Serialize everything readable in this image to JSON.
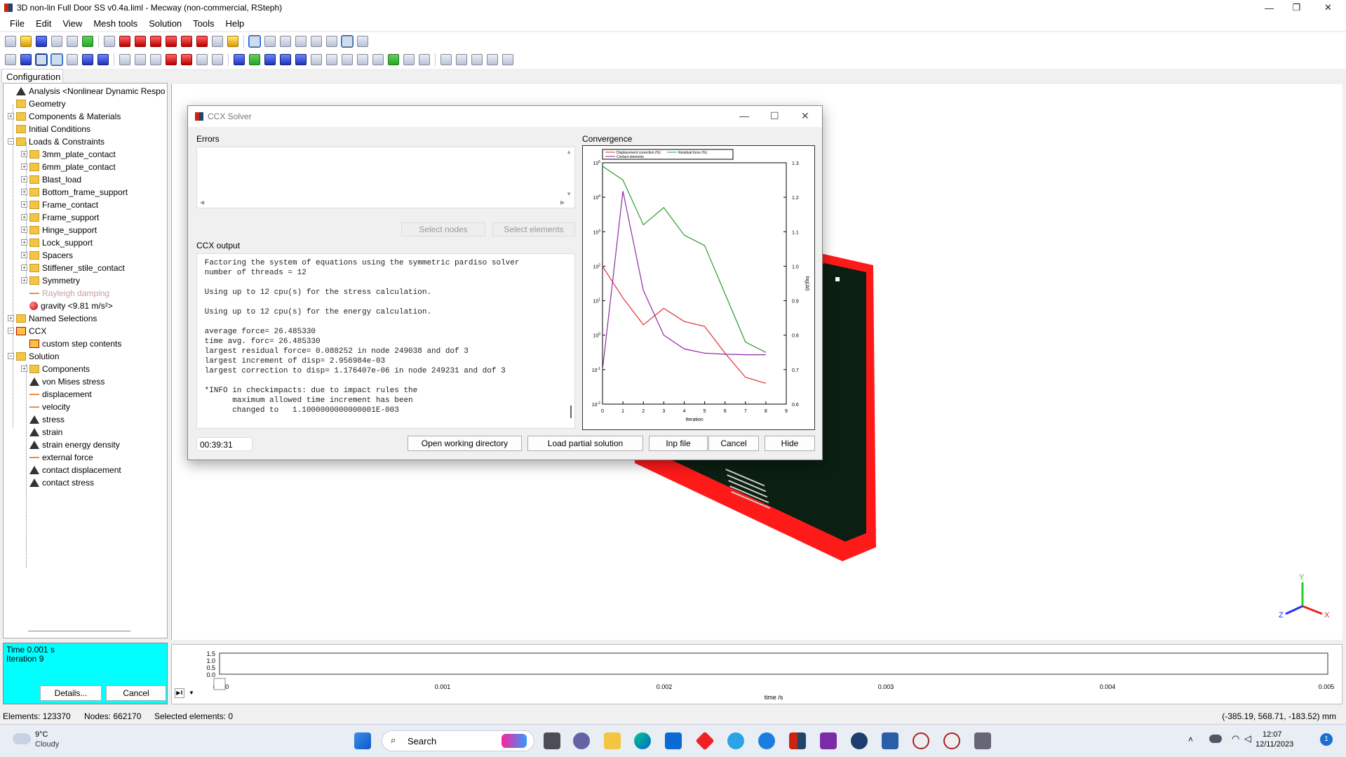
{
  "window": {
    "title": "3D non-lin Full Door SS v0.4a.liml - Mecway (non-commercial, RSteph)"
  },
  "menu": [
    "File",
    "Edit",
    "View",
    "Mesh tools",
    "Solution",
    "Tools",
    "Help"
  ],
  "config_tab": "Configuration",
  "tree": [
    {
      "label": "Analysis <Nonlinear Dynamic Respo",
      "icon": "analysis-icon",
      "level": 0,
      "expander": ""
    },
    {
      "label": "Geometry",
      "icon": "folder-icon",
      "level": 0,
      "expander": ""
    },
    {
      "label": "Components & Materials",
      "icon": "folder-icon",
      "level": 0,
      "expander": "+"
    },
    {
      "label": "Initial Conditions",
      "icon": "initial-conditions-icon",
      "level": 0,
      "expander": ""
    },
    {
      "label": "Loads & Constraints",
      "icon": "folder-icon",
      "level": 0,
      "expander": "-"
    },
    {
      "label": "3mm_plate_contact",
      "icon": "folder-icon",
      "level": 1,
      "expander": "+"
    },
    {
      "label": "6mm_plate_contact",
      "icon": "folder-icon",
      "level": 1,
      "expander": "+"
    },
    {
      "label": "Blast_load",
      "icon": "folder-icon",
      "level": 1,
      "expander": "+"
    },
    {
      "label": "Bottom_frame_support",
      "icon": "folder-icon",
      "level": 1,
      "expander": "+"
    },
    {
      "label": "Frame_contact",
      "icon": "folder-icon",
      "level": 1,
      "expander": "+"
    },
    {
      "label": "Frame_support",
      "icon": "folder-icon",
      "level": 1,
      "expander": "+"
    },
    {
      "label": "Hinge_support",
      "icon": "folder-icon",
      "level": 1,
      "expander": "+"
    },
    {
      "label": "Lock_support",
      "icon": "folder-icon",
      "level": 1,
      "expander": "+"
    },
    {
      "label": "Spacers",
      "icon": "folder-icon",
      "level": 1,
      "expander": "+"
    },
    {
      "label": "Stiffener_stile_contact",
      "icon": "folder-icon",
      "level": 1,
      "expander": "+"
    },
    {
      "label": "Symmetry",
      "icon": "folder-icon",
      "level": 1,
      "expander": "+"
    },
    {
      "label": "Rayleigh damping",
      "icon": "damping-icon",
      "level": 1,
      "expander": "",
      "disabled": true
    },
    {
      "label": "gravity <9.81 m/s²>",
      "icon": "gravity-icon",
      "level": 1,
      "expander": ""
    },
    {
      "label": "Named Selections",
      "icon": "folder-icon",
      "level": 0,
      "expander": "+"
    },
    {
      "label": "CCX",
      "icon": "ccx-icon",
      "level": 0,
      "expander": "-"
    },
    {
      "label": "custom step contents",
      "icon": "ccx-icon",
      "level": 1,
      "expander": ""
    },
    {
      "label": "Solution",
      "icon": "solution-icon",
      "level": 0,
      "expander": "-"
    },
    {
      "label": "Components",
      "icon": "folder-icon",
      "level": 1,
      "expander": "+"
    },
    {
      "label": "von Mises stress",
      "icon": "triangle-icon",
      "level": 1,
      "expander": ""
    },
    {
      "label": "displacement",
      "icon": "arrow-icon",
      "level": 1,
      "expander": ""
    },
    {
      "label": "velocity",
      "icon": "arrow-icon",
      "level": 1,
      "expander": ""
    },
    {
      "label": "stress",
      "icon": "triangle-icon",
      "level": 1,
      "expander": ""
    },
    {
      "label": "strain",
      "icon": "triangle-icon",
      "level": 1,
      "expander": ""
    },
    {
      "label": "strain energy density",
      "icon": "triangle-icon",
      "level": 1,
      "expander": ""
    },
    {
      "label": "external force",
      "icon": "arrow-icon",
      "level": 1,
      "expander": ""
    },
    {
      "label": "contact displacement",
      "icon": "triangle-icon",
      "level": 1,
      "expander": ""
    },
    {
      "label": "contact stress",
      "icon": "triangle-icon",
      "level": 1,
      "expander": ""
    }
  ],
  "solve_status": {
    "time": "Time 0.001 s",
    "iteration": "Iteration 9",
    "details": "Details...",
    "cancel": "Cancel"
  },
  "timeline": {
    "yticks": [
      "1.5",
      "1.0",
      "0.5",
      "0.0"
    ],
    "xticks": [
      "0.000",
      "0.001",
      "0.002",
      "0.003",
      "0.004",
      "0.005"
    ],
    "xlabel": "time /s"
  },
  "statusbar": {
    "elements": "Elements: 123370",
    "nodes": "Nodes: 662170",
    "selected": "Selected elements: 0",
    "coords": "(-385.19, 568.71, -183.52) mm"
  },
  "axes_triad": {
    "x": "X",
    "y": "Y",
    "z": "Z"
  },
  "dialog": {
    "title": "CCX Solver",
    "errors_label": "Errors",
    "select_nodes": "Select nodes",
    "select_elements": "Select elements",
    "output_label": "CCX output",
    "output_lines": [
      " Factoring the system of equations using the symmetric pardiso solver",
      " number of threads = 12",
      "",
      " Using up to 12 cpu(s) for the stress calculation.",
      "",
      " Using up to 12 cpu(s) for the energy calculation.",
      "",
      " average force= 26.485330",
      " time avg. forc= 26.485330",
      " largest residual force= 0.088252 in node 249038 and dof 3",
      " largest increment of disp= 2.956984e-03",
      " largest correction to disp= 1.176407e-06 in node 249231 and dof 3",
      "",
      " *INFO in checkimpacts: due to impact rules the",
      "       maximum allowed time increment has been",
      "       changed to   1.1000000000000001E-003"
    ],
    "elapsed": "00:39:31",
    "buttons": {
      "open_dir": "Open working directory",
      "load_partial": "Load partial solution",
      "inp_file": "Inp file",
      "cancel": "Cancel",
      "hide": "Hide"
    },
    "convergence_label": "Convergence"
  },
  "chart_data": {
    "type": "line",
    "xlabel": "Iteration",
    "ylabel_right": "log(Δt)",
    "x_ticks": [
      0,
      1,
      2,
      3,
      4,
      5,
      6,
      7,
      8,
      9
    ],
    "y_left_log": true,
    "ylim_left": [
      0.01,
      100000
    ],
    "ylim_right": [
      0.6,
      1.3
    ],
    "y_right_ticks": [
      "1.3",
      "1.2",
      "1.1",
      "1.0",
      "0.9",
      "0.8",
      "0.7",
      "0.6"
    ],
    "legend_placement": "top",
    "series": [
      {
        "name": "Displacement correction (%)",
        "color": "#e03030",
        "axis": "left",
        "x": [
          0,
          1,
          2,
          3,
          4,
          5,
          6,
          7,
          8
        ],
        "y": [
          100,
          12,
          2,
          6,
          2.5,
          1.8,
          0.3,
          0.06,
          0.04
        ]
      },
      {
        "name": "Residual force (%)",
        "color": "#2e9a2e",
        "axis": "right",
        "x": [
          0,
          1,
          2,
          3,
          4,
          5,
          6,
          7,
          8
        ],
        "y": [
          1.29,
          1.25,
          1.12,
          1.17,
          1.09,
          1.06,
          0.92,
          0.78,
          0.75
        ]
      },
      {
        "name": "Contact elements",
        "color": "#8e2aa0",
        "axis": "left",
        "x": [
          0,
          1,
          2,
          3,
          4,
          5,
          6,
          7,
          8
        ],
        "y": [
          0.1,
          15000,
          20,
          1,
          0.4,
          0.3,
          0.28,
          0.27,
          0.27
        ]
      }
    ]
  },
  "taskbar": {
    "weather_temp": "9°C",
    "weather_desc": "Cloudy",
    "search": "Search",
    "time": "12:07",
    "date": "12/11/2023",
    "notif": "1"
  }
}
